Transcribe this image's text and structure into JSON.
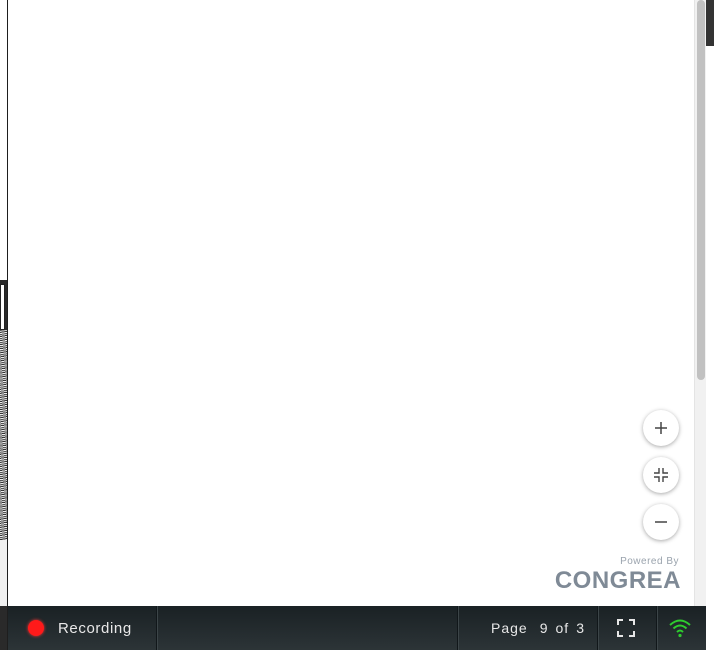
{
  "zoom_controls": {
    "zoom_in_icon": "plus-icon",
    "fit_icon": "collapse-icon",
    "zoom_out_icon": "minus-icon"
  },
  "branding": {
    "powered_by": "Powered By",
    "logo_text": "CONGREA"
  },
  "status_bar": {
    "recording_label": "Recording",
    "recording_color": "#ff1a1a",
    "page_label": "Page",
    "page_current": "9",
    "page_of": "of",
    "page_total": "3",
    "fullscreen_icon": "fullscreen-icon",
    "network_icon": "wifi-icon",
    "network_color": "#2ecc2e"
  }
}
